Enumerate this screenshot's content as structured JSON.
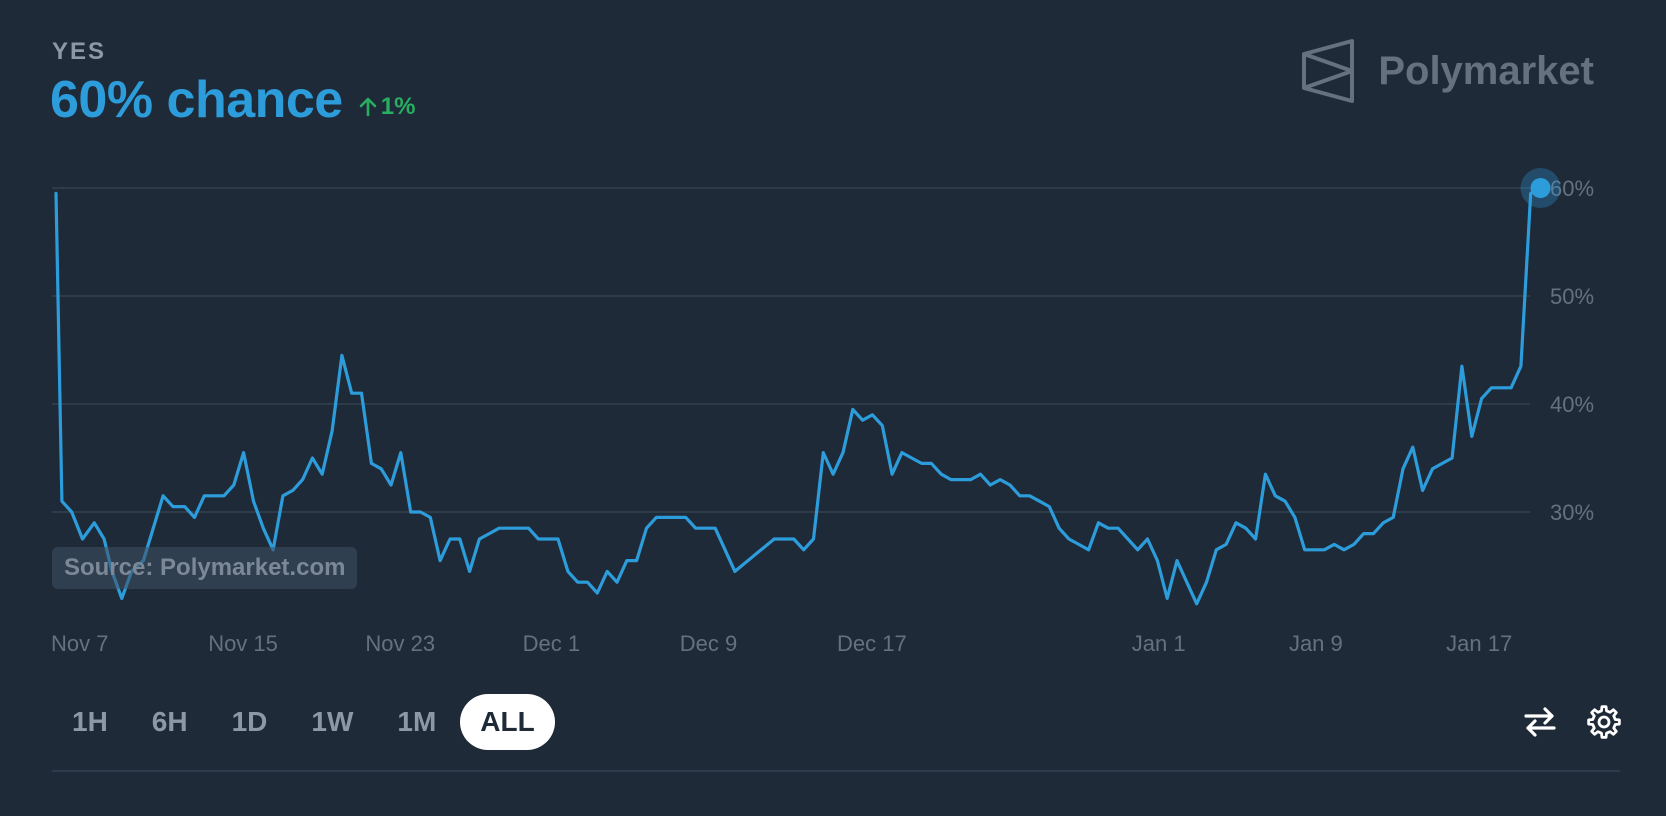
{
  "header": {
    "outcome": "YES",
    "chance_text": "60% chance",
    "delta_text": "1%",
    "delta_direction": "up",
    "delta_icon": "arrow-up-icon",
    "brand": "Polymarket",
    "brand_icon": "polymarket-logo-icon"
  },
  "source_label": "Source: Polymarket.com",
  "range_buttons": [
    {
      "label": "1H",
      "active": false
    },
    {
      "label": "6H",
      "active": false
    },
    {
      "label": "1D",
      "active": false
    },
    {
      "label": "1W",
      "active": false
    },
    {
      "label": "1M",
      "active": false
    },
    {
      "label": "ALL",
      "active": true
    }
  ],
  "tools": {
    "swap_icon": "swap-arrows-icon",
    "settings_icon": "gear-icon"
  },
  "colors": {
    "background": "#1e2a38",
    "line": "#2d9cdb",
    "positive": "#27ae60",
    "grid": "#34414f",
    "muted_text": "#66717e"
  },
  "chart_data": {
    "type": "line",
    "title": "",
    "xlabel": "",
    "ylabel": "",
    "ylim": [
      20,
      62
    ],
    "x_range_days": [
      0,
      74
    ],
    "y_ticks": [
      {
        "value": 30,
        "label": "30%"
      },
      {
        "value": 40,
        "label": "40%"
      },
      {
        "value": 50,
        "label": "50%"
      },
      {
        "value": 60,
        "label": "60%"
      }
    ],
    "x_ticks": [
      {
        "day": 0,
        "label": "Nov 7"
      },
      {
        "day": 8,
        "label": "Nov 15"
      },
      {
        "day": 16,
        "label": "Nov 23"
      },
      {
        "day": 24,
        "label": "Dec 1"
      },
      {
        "day": 32,
        "label": "Dec 9"
      },
      {
        "day": 40,
        "label": "Dec 17"
      },
      {
        "day": 55,
        "label": "Jan 1"
      },
      {
        "day": 63,
        "label": "Jan 9"
      },
      {
        "day": 71,
        "label": "Jan 17"
      }
    ],
    "grid": true,
    "series": [
      {
        "name": "",
        "points": [
          [
            0.05,
            59.5
          ],
          [
            0.35,
            31
          ],
          [
            0.85,
            30
          ],
          [
            1.4,
            27.5
          ],
          [
            2.0,
            29
          ],
          [
            2.5,
            27.5
          ],
          [
            2.9,
            24.5
          ],
          [
            3.4,
            22
          ],
          [
            3.9,
            24.5
          ],
          [
            4.5,
            25.5
          ],
          [
            5.5,
            31.5
          ],
          [
            6.0,
            30.5
          ],
          [
            6.6,
            30.5
          ],
          [
            7.1,
            29.5
          ],
          [
            7.6,
            31.5
          ],
          [
            8.6,
            31.5
          ],
          [
            9.1,
            32.5
          ],
          [
            9.6,
            35.5
          ],
          [
            10.1,
            31
          ],
          [
            10.6,
            28.5
          ],
          [
            11.1,
            26.5
          ],
          [
            11.6,
            31.5
          ],
          [
            12.1,
            32
          ],
          [
            12.6,
            33
          ],
          [
            13.1,
            35
          ],
          [
            13.6,
            33.5
          ],
          [
            14.1,
            37.5
          ],
          [
            14.6,
            44.5
          ],
          [
            15.1,
            41
          ],
          [
            15.6,
            41
          ],
          [
            16.1,
            34.5
          ],
          [
            16.6,
            34
          ],
          [
            17.1,
            32.5
          ],
          [
            17.6,
            35.5
          ],
          [
            18.1,
            30
          ],
          [
            18.6,
            30
          ],
          [
            19.1,
            29.5
          ],
          [
            19.6,
            25.5
          ],
          [
            20.1,
            27.5
          ],
          [
            20.6,
            27.5
          ],
          [
            21.1,
            24.5
          ],
          [
            21.6,
            27.5
          ],
          [
            22.1,
            28
          ],
          [
            22.6,
            28.5
          ],
          [
            24.1,
            28.5
          ],
          [
            24.6,
            27.5
          ],
          [
            25.6,
            27.5
          ],
          [
            26.1,
            24.5
          ],
          [
            26.6,
            23.5
          ],
          [
            27.1,
            23.5
          ],
          [
            27.6,
            22.5
          ],
          [
            28.1,
            24.5
          ],
          [
            28.6,
            23.5
          ],
          [
            29.1,
            25.5
          ],
          [
            29.6,
            25.5
          ],
          [
            30.1,
            28.5
          ],
          [
            30.6,
            29.5
          ],
          [
            32.1,
            29.5
          ],
          [
            32.6,
            28.5
          ],
          [
            33.6,
            28.5
          ],
          [
            34.6,
            24.5
          ],
          [
            35.6,
            26
          ],
          [
            36.6,
            27.5
          ],
          [
            37.6,
            27.5
          ],
          [
            38.1,
            26.5
          ],
          [
            38.6,
            27.5
          ],
          [
            39.1,
            35.5
          ],
          [
            39.6,
            33.5
          ],
          [
            40.1,
            35.5
          ],
          [
            40.6,
            39.5
          ],
          [
            41.1,
            38.5
          ],
          [
            41.6,
            39
          ],
          [
            42.1,
            38
          ],
          [
            42.6,
            33.5
          ],
          [
            43.1,
            35.5
          ],
          [
            43.6,
            35
          ],
          [
            44.1,
            34.5
          ],
          [
            44.6,
            34.5
          ],
          [
            45.1,
            33.5
          ],
          [
            45.6,
            33
          ],
          [
            46.6,
            33
          ],
          [
            47.1,
            33.5
          ],
          [
            47.6,
            32.5
          ],
          [
            48.1,
            33
          ],
          [
            48.6,
            32.5
          ],
          [
            49.1,
            31.5
          ],
          [
            49.6,
            31.5
          ],
          [
            50.1,
            31
          ],
          [
            50.6,
            30.5
          ],
          [
            51.1,
            28.5
          ],
          [
            51.6,
            27.5
          ],
          [
            52.1,
            27
          ],
          [
            52.6,
            26.5
          ],
          [
            53.1,
            29
          ],
          [
            53.6,
            28.5
          ],
          [
            54.1,
            28.5
          ],
          [
            54.6,
            27.5
          ],
          [
            55.1,
            26.5
          ],
          [
            55.6,
            27.5
          ],
          [
            56.1,
            25.5
          ],
          [
            56.6,
            22
          ],
          [
            57.1,
            25.5
          ],
          [
            57.6,
            23.5
          ],
          [
            58.1,
            21.5
          ],
          [
            58.6,
            23.5
          ],
          [
            59.1,
            26.5
          ],
          [
            59.6,
            27
          ],
          [
            60.1,
            29
          ],
          [
            60.6,
            28.5
          ],
          [
            61.1,
            27.5
          ],
          [
            61.6,
            33.5
          ],
          [
            62.1,
            31.5
          ],
          [
            62.6,
            31
          ],
          [
            63.1,
            29.5
          ],
          [
            63.6,
            26.5
          ],
          [
            64.6,
            26.5
          ],
          [
            65.1,
            27
          ],
          [
            65.6,
            26.5
          ],
          [
            66.1,
            27
          ],
          [
            66.6,
            28
          ],
          [
            67.1,
            28
          ],
          [
            67.6,
            29
          ],
          [
            68.1,
            29.5
          ],
          [
            68.6,
            34
          ],
          [
            69.1,
            36
          ],
          [
            69.6,
            32
          ],
          [
            70.1,
            34
          ],
          [
            70.6,
            34.5
          ],
          [
            71.1,
            35
          ],
          [
            71.6,
            43.5
          ],
          [
            72.1,
            37
          ],
          [
            72.6,
            40.5
          ],
          [
            73.1,
            41.5
          ],
          [
            73.6,
            41.5
          ],
          [
            74.1,
            41.5
          ],
          [
            74.6,
            43.5
          ],
          [
            75.1,
            59.5
          ],
          [
            75.6,
            60
          ]
        ]
      }
    ]
  }
}
